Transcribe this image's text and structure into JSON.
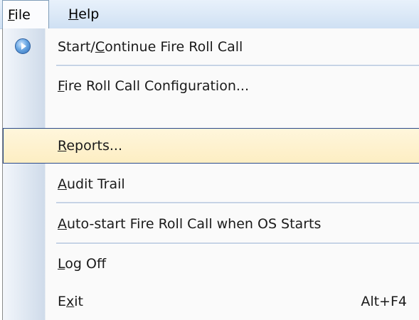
{
  "menubar": {
    "file": {
      "mnemonic": "F",
      "rest": "ile"
    },
    "help": {
      "mnemonic": "H",
      "rest": "elp"
    }
  },
  "file_menu": {
    "items": [
      {
        "pre": "Start/",
        "mnemonic": "C",
        "post": "ontinue Fire Roll Call",
        "icon": "play-circle-icon"
      },
      {
        "pre": "",
        "mnemonic": "F",
        "post": "ire Roll Call Configuration..."
      },
      {
        "pre": "",
        "mnemonic": "R",
        "post": "eports...",
        "highlighted": true
      },
      {
        "pre": "",
        "mnemonic": "A",
        "post": "udit Trail"
      },
      {
        "pre": "",
        "mnemonic": "A",
        "post": "uto-start Fire Roll Call when OS Starts"
      },
      {
        "pre": "",
        "mnemonic": "L",
        "post": "og Off"
      },
      {
        "pre": "E",
        "mnemonic": "x",
        "post": "it",
        "shortcut": "Alt+F4"
      }
    ]
  }
}
